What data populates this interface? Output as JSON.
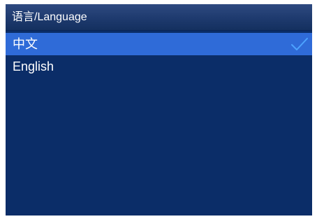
{
  "header": {
    "title": "语言/Language"
  },
  "languages": [
    {
      "label": "中文",
      "selected": true
    },
    {
      "label": "English",
      "selected": false
    }
  ],
  "colors": {
    "background": "#0b2d68",
    "header": "#1e3a6e",
    "selected_row": "#2f6bd8",
    "checkmark": "#4da3ff",
    "text": "#ffffff"
  },
  "icons": {
    "selected_marker": "check-icon"
  }
}
